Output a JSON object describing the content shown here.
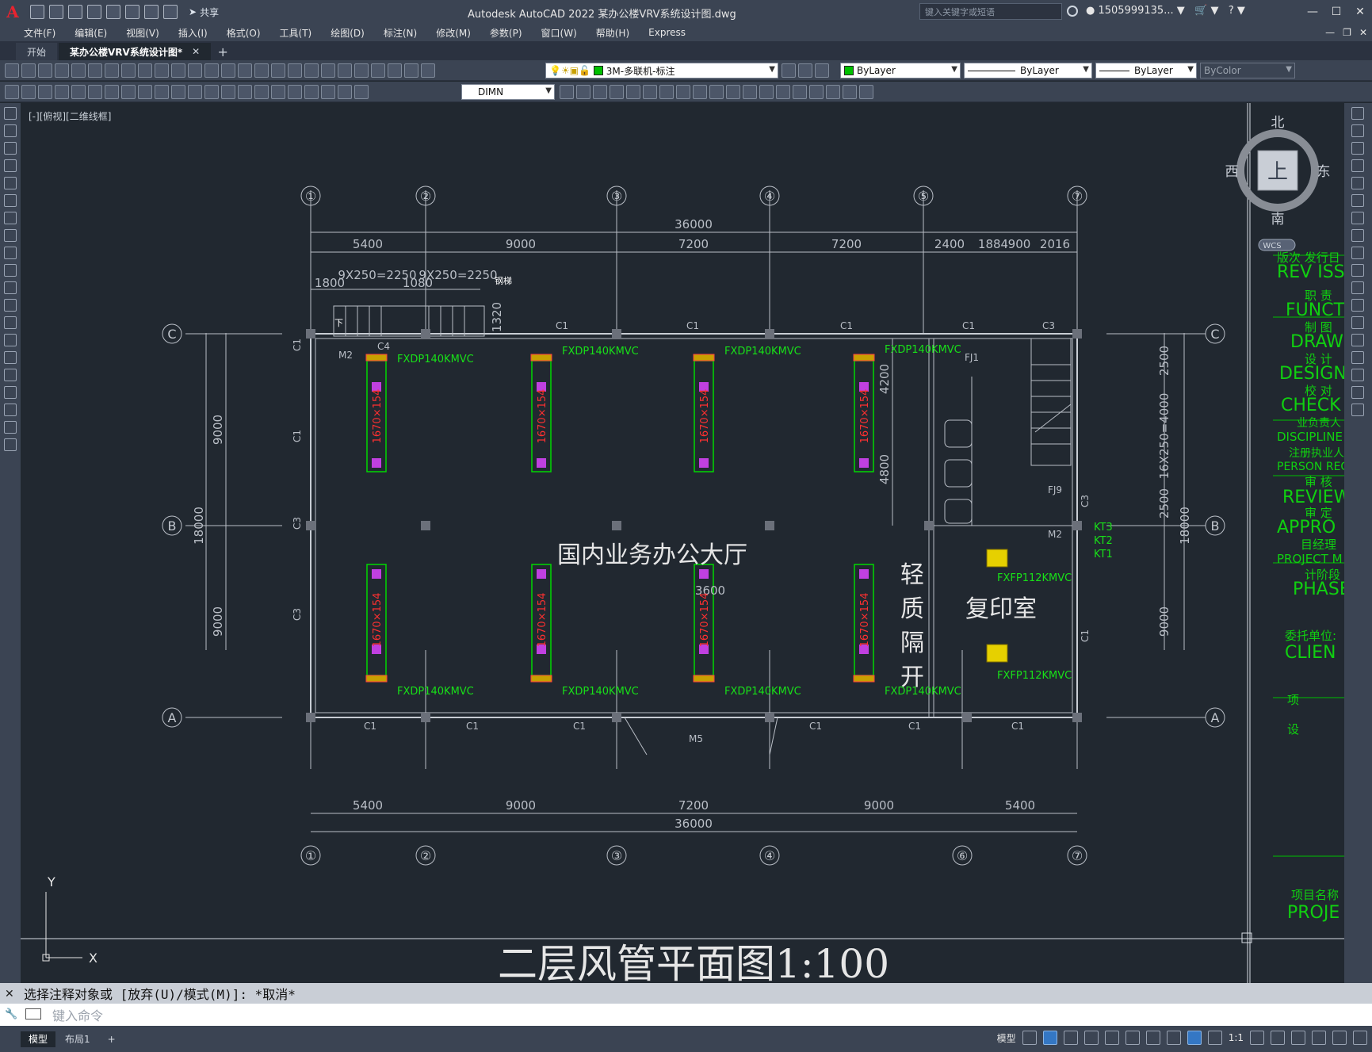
{
  "app": {
    "logo": "A",
    "title": "Autodesk AutoCAD 2022    某办公楼VRV系统设计图.dwg",
    "share_label": "共享",
    "search_placeholder": "键入关键字或短语",
    "user": "1505999135...",
    "window_controls": [
      "—",
      "☐",
      "✕"
    ],
    "mdi_controls": [
      "—",
      "❐",
      "✕"
    ]
  },
  "menu": {
    "items": [
      "文件(F)",
      "编辑(E)",
      "视图(V)",
      "插入(I)",
      "格式(O)",
      "工具(T)",
      "绘图(D)",
      "标注(N)",
      "修改(M)",
      "参数(P)",
      "窗口(W)",
      "帮助(H)",
      "Express"
    ]
  },
  "tabs": {
    "start": "开始",
    "active": "某办公楼VRV系统设计图*",
    "close": "✕",
    "new": "+"
  },
  "toolbar": {
    "layer": "3M-多联机-标注",
    "color": "ByLayer",
    "linetype": "ByLayer",
    "lineweight": "ByLayer",
    "plotstyle": "ByColor",
    "dimstyle": "DIMN",
    "layer_color": "#00c000"
  },
  "viewport": {
    "label": "[-][俯视][二维线框]"
  },
  "viewcube": {
    "north": "北",
    "south": "南",
    "east": "东",
    "west": "西",
    "face": "上",
    "wcs": "WCS"
  },
  "drawing": {
    "grid_top": [
      "①",
      "②",
      "③",
      "④",
      "⑤",
      "⑦"
    ],
    "grid_bottom": [
      "①",
      "②",
      "③",
      "④",
      "⑥",
      "⑦"
    ],
    "grid_rows": [
      "C",
      "B",
      "A"
    ],
    "total_width": "36000",
    "top_dims": [
      "5400",
      "9000",
      "7200",
      "7200",
      "2400",
      "1884",
      "900",
      "2016"
    ],
    "bottom_dims": [
      "5400",
      "9000",
      "7200",
      "9000",
      "5400"
    ],
    "stair_dims": [
      "1800",
      "9X250=2250",
      "1080",
      "9X250=2250"
    ],
    "stair_label": "1320",
    "stair_note": "钢梯",
    "down_label": "下",
    "side_left": [
      "9000",
      "18000",
      "9000"
    ],
    "side_right": [
      "2500",
      "16X250=4000",
      "2500",
      "18000",
      "9000"
    ],
    "inner_dims": [
      "4200",
      "4800",
      "3600"
    ],
    "windows_top": [
      "C4",
      "C1",
      "C1",
      "C1",
      "C1",
      "C3"
    ],
    "windows_bottom": [
      "C1",
      "C1",
      "C1",
      "C1",
      "C1",
      "C1"
    ],
    "windows_left": [
      "C1",
      "C1",
      "C3",
      "C3"
    ],
    "door_labels": [
      "M2",
      "M2",
      "M5",
      "FJ1",
      "FJ9",
      "C3",
      "C1"
    ],
    "units_top": [
      "FXDP140KMVC",
      "FXDP140KMVC",
      "FXDP140KMVC",
      "FXDP140KMVC"
    ],
    "units_bottom": [
      "FXDP140KMVC",
      "FXDP140KMVC",
      "FXDP140KMVC",
      "FXDP140KMVC"
    ],
    "duct_label": "1670×154",
    "copy_units": [
      "FXFP112KMVC",
      "FXFP112KMVC"
    ],
    "kt_labels": [
      "KT3",
      "KT2",
      "KT1"
    ],
    "hall_name": "国内业务办公大厅",
    "partition_chars": [
      "轻",
      "质",
      "隔",
      "开"
    ],
    "copy_room": "复印室",
    "plan_title": "二层风管平面图1:100",
    "ucs_x": "X",
    "ucs_y": "Y"
  },
  "title_block": {
    "rows": [
      "版次  发行日",
      "REV  ISSU",
      "职  责",
      "FUNCT",
      "制  图",
      "DRAW",
      "设  计",
      "DESIGN",
      "校  对",
      "CHECK",
      "业负责人",
      "DISCIPLINE",
      "注册执业人",
      "PERSON REG",
      "审  核",
      "REVIEW",
      "审  定",
      "APPRO",
      "目经理",
      "PROJECT M",
      "计阶段",
      "PHASE",
      "委托单位:",
      "CLIEN",
      "项",
      "设",
      "项目名称",
      "PROJE"
    ]
  },
  "command": {
    "history": "选择注释对象或 [放弃(U)/模式(M)]: *取消*",
    "placeholder": "键入命令"
  },
  "status": {
    "layouts": [
      "模型",
      "布局1",
      "+"
    ],
    "model_label": "模型",
    "scale": "1:1"
  }
}
